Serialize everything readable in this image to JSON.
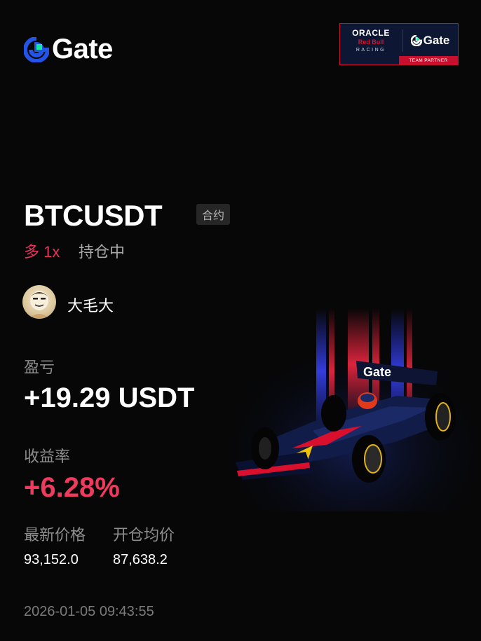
{
  "brand": {
    "name": "Gate"
  },
  "partner_badge": {
    "oracle": "ORACLE",
    "red_bull": "Red Bull",
    "racing": "RACING",
    "gate": "Gate",
    "team_partner": "TEAM PARTNER"
  },
  "position": {
    "pair": "BTCUSDT",
    "type_tag": "合约",
    "direction": "多 1x",
    "status": "持仓中"
  },
  "user": {
    "name": "大毛大",
    "avatar_icon": "avatar-icon"
  },
  "pnl": {
    "label": "盈亏",
    "value": "+19.29 USDT"
  },
  "roe": {
    "label": "收益率",
    "value": "+6.28%"
  },
  "latest_price": {
    "label": "最新价格",
    "value": "93,152.0"
  },
  "entry_price": {
    "label": "开仓均价",
    "value": "87,638.2"
  },
  "timestamp": "2026-01-05 09:43:55",
  "colors": {
    "background": "#070707",
    "positive": "#ee3a5c",
    "muted": "#8d8d8d",
    "brand_blue": "#2354e6",
    "brand_green": "#17e6a1"
  },
  "car_livery": {
    "text": "Gate"
  }
}
